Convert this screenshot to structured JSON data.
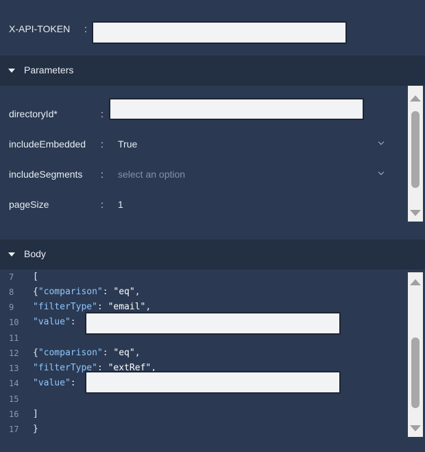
{
  "header": {
    "token_label": "X-API-TOKEN",
    "colon": ":"
  },
  "parameters": {
    "title": "Parameters",
    "fields": [
      {
        "label": "directoryId*",
        "colon": ":",
        "value": ""
      },
      {
        "label": "includeEmbedded",
        "colon": ":",
        "value": "True"
      },
      {
        "label": "includeSegments",
        "colon": ":",
        "placeholder": "select an option"
      },
      {
        "label": "pageSize",
        "colon": ":",
        "value": "1"
      }
    ]
  },
  "body": {
    "title": "Body",
    "lines": [
      {
        "n": "7"
      },
      {
        "n": "8"
      },
      {
        "n": "9"
      },
      {
        "n": "10"
      },
      {
        "n": "11"
      },
      {
        "n": "12"
      },
      {
        "n": "13"
      },
      {
        "n": "14"
      },
      {
        "n": "15"
      },
      {
        "n": "16"
      },
      {
        "n": "17"
      }
    ],
    "tokens": {
      "open_bracket": "[",
      "brace_open": "{",
      "comparison_key": "\"comparison\"",
      "eq_value": "\"eq\"",
      "filterType_key": "\"filterType\"",
      "email_value": "\"email\"",
      "extRef_value": "\"extRef\"",
      "value_key": "\"value\"",
      "close_bracket": "]",
      "close_brace": "}"
    }
  },
  "colors": {
    "background": "#2b3a52",
    "section_bar": "#232f42",
    "json_key": "#8fc7ff"
  }
}
